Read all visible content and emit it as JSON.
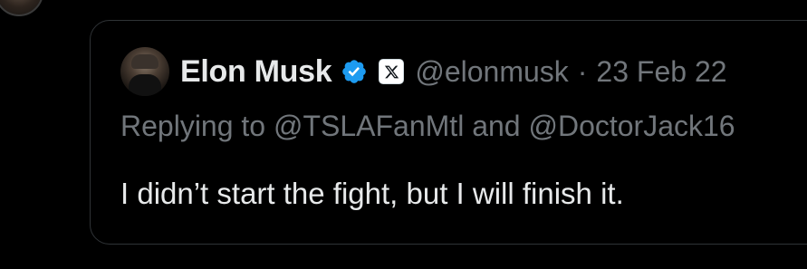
{
  "quoted_tweet": {
    "author": {
      "display_name": "Elon Musk",
      "handle": "@elonmusk",
      "avatar_icon": "profile-photo",
      "verified_icon": "verified-badge-icon",
      "affiliation_icon": "x-logo-icon"
    },
    "separator": "·",
    "timestamp": "23 Feb 22",
    "replying_to": {
      "prefix": "Replying to",
      "first_mention": "@TSLAFanMtl",
      "conjunction": "and",
      "second_mention": "@DoctorJack16"
    },
    "text": "I didn’t start the fight, but I will finish it."
  },
  "colors": {
    "background": "#000000",
    "border": "#2f3336",
    "primary_text": "#e7e9ea",
    "secondary_text": "#71767b",
    "verified_blue": "#1d9bf0"
  }
}
